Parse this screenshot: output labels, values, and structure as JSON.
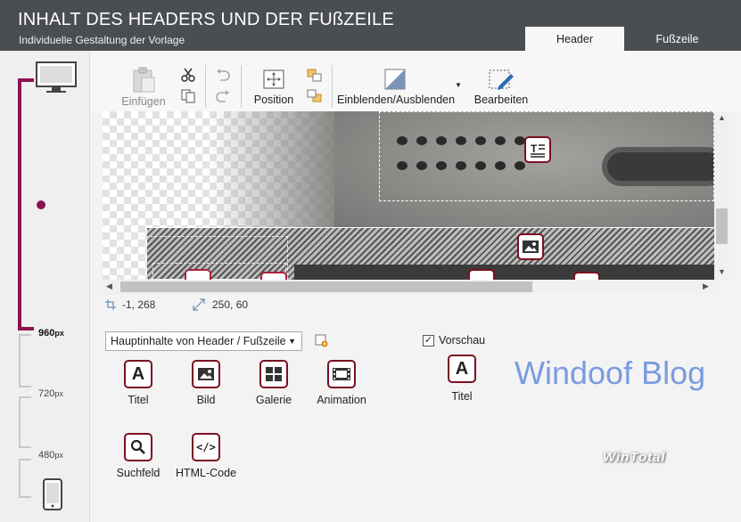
{
  "header": {
    "title": "INHALT DES HEADERS UND DER FUßZEILE",
    "subtitle": "Individuelle Gestaltung der Vorlage",
    "tabs": [
      {
        "label": "Header",
        "active": true
      },
      {
        "label": "Fußzeile",
        "active": false
      }
    ]
  },
  "breakpoints": {
    "labels": [
      {
        "value": "960",
        "unit": "px"
      },
      {
        "value": "720",
        "unit": "px"
      },
      {
        "value": "480",
        "unit": "px"
      }
    ],
    "accent_color": "#8b1450"
  },
  "toolbar": {
    "paste_label": "Einfügen",
    "position_label": "Position",
    "toggle_label": "Einblenden/Ausblenden",
    "edit_label": "Bearbeiten"
  },
  "status": {
    "position": "-1, 268",
    "size": "250, 60"
  },
  "elements": {
    "dropdown_value": "Hauptinhalte von Header / Fußzeile",
    "items": [
      {
        "label": "Titel",
        "icon": "title-icon"
      },
      {
        "label": "Bild",
        "icon": "image-icon"
      },
      {
        "label": "Galerie",
        "icon": "gallery-icon"
      },
      {
        "label": "Animation",
        "icon": "animation-icon"
      },
      {
        "label": "Suchfeld",
        "icon": "search-icon"
      },
      {
        "label": "HTML-Code",
        "icon": "code-icon"
      }
    ]
  },
  "preview": {
    "checkbox_label": "Vorschau",
    "checked": true,
    "item_label": "Titel",
    "item_letter": "A"
  },
  "watermark": {
    "blog_text": "Windoof Blog",
    "logo_text": "WinTotal"
  },
  "colors": {
    "titlebar": "#4a4d52",
    "icon_border": "#7a1020",
    "watermark": "#7a9be0"
  }
}
